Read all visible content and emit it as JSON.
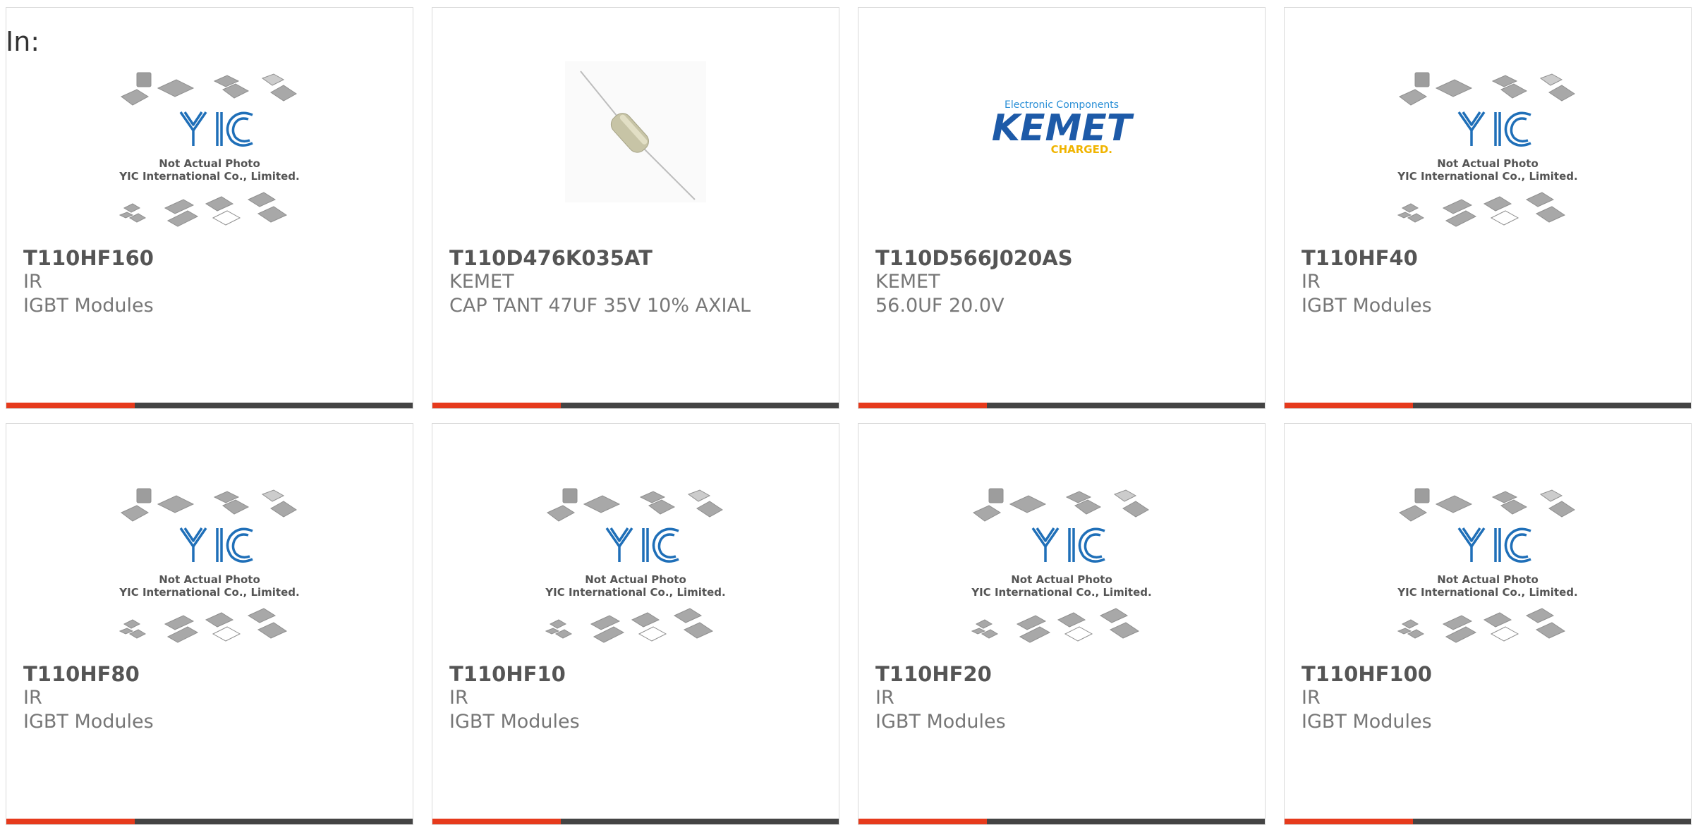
{
  "header": {
    "in_label": "In:"
  },
  "theme": {
    "accent": "#e63a1c",
    "bar": "#444444",
    "logo_blue": "#1f6fb8"
  },
  "placeholder": {
    "line1": "Not Actual Photo",
    "line2": "YIC International Co., Limited.",
    "logo_text": "YIC"
  },
  "kemet": {
    "tagline": "Electronic Components",
    "name": "KEMET",
    "charged": "CHARGED."
  },
  "products": [
    {
      "part": "T110HF160",
      "brand": "IR",
      "desc": "IGBT Modules",
      "image": "placeholder"
    },
    {
      "part": "T110D476K035AT",
      "brand": "KEMET",
      "desc": "CAP TANT 47UF 35V 10% AXIAL",
      "image": "axial-capacitor"
    },
    {
      "part": "T110D566J020AS",
      "brand": "KEMET",
      "desc": "56.0UF 20.0V",
      "image": "kemet-logo"
    },
    {
      "part": "T110HF40",
      "brand": "IR",
      "desc": "IGBT Modules",
      "image": "placeholder"
    },
    {
      "part": "T110HF80",
      "brand": "IR",
      "desc": "IGBT Modules",
      "image": "placeholder"
    },
    {
      "part": "T110HF10",
      "brand": "IR",
      "desc": "IGBT Modules",
      "image": "placeholder"
    },
    {
      "part": "T110HF20",
      "brand": "IR",
      "desc": "IGBT Modules",
      "image": "placeholder"
    },
    {
      "part": "T110HF100",
      "brand": "IR",
      "desc": "IGBT Modules",
      "image": "placeholder"
    }
  ]
}
